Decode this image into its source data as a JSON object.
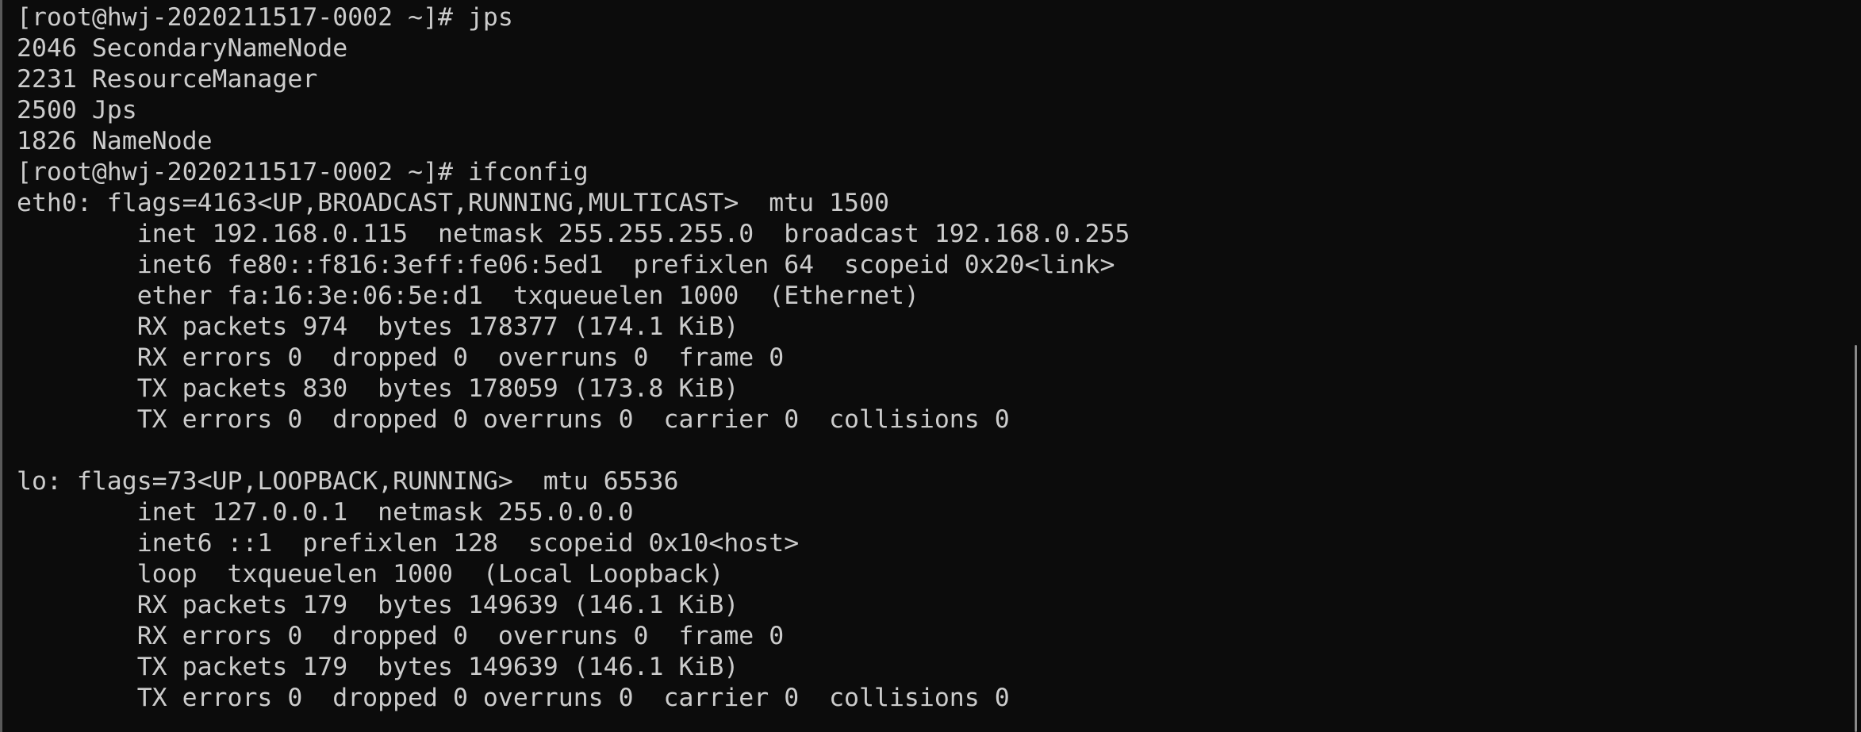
{
  "terminal": {
    "lines": [
      "[root@hwj-2020211517-0002 ~]# jps",
      "2046 SecondaryNameNode",
      "2231 ResourceManager",
      "2500 Jps",
      "1826 NameNode",
      "[root@hwj-2020211517-0002 ~]# ifconfig",
      "eth0: flags=4163<UP,BROADCAST,RUNNING,MULTICAST>  mtu 1500",
      "        inet 192.168.0.115  netmask 255.255.255.0  broadcast 192.168.0.255",
      "        inet6 fe80::f816:3eff:fe06:5ed1  prefixlen 64  scopeid 0x20<link>",
      "        ether fa:16:3e:06:5e:d1  txqueuelen 1000  (Ethernet)",
      "        RX packets 974  bytes 178377 (174.1 KiB)",
      "        RX errors 0  dropped 0  overruns 0  frame 0",
      "        TX packets 830  bytes 178059 (173.8 KiB)",
      "        TX errors 0  dropped 0 overruns 0  carrier 0  collisions 0",
      "",
      "lo: flags=73<UP,LOOPBACK,RUNNING>  mtu 65536",
      "        inet 127.0.0.1  netmask 255.0.0.0",
      "        inet6 ::1  prefixlen 128  scopeid 0x10<host>",
      "        loop  txqueuelen 1000  (Local Loopback)",
      "        RX packets 179  bytes 149639 (146.1 KiB)",
      "        RX errors 0  dropped 0  overruns 0  frame 0",
      "        TX packets 179  bytes 149639 (146.1 KiB)",
      "        TX errors 0  dropped 0 overruns 0  carrier 0  collisions 0"
    ]
  },
  "colors": {
    "background": "#0c0c0c",
    "text": "#cccccc",
    "scrollbar": "#8a8a8a"
  }
}
